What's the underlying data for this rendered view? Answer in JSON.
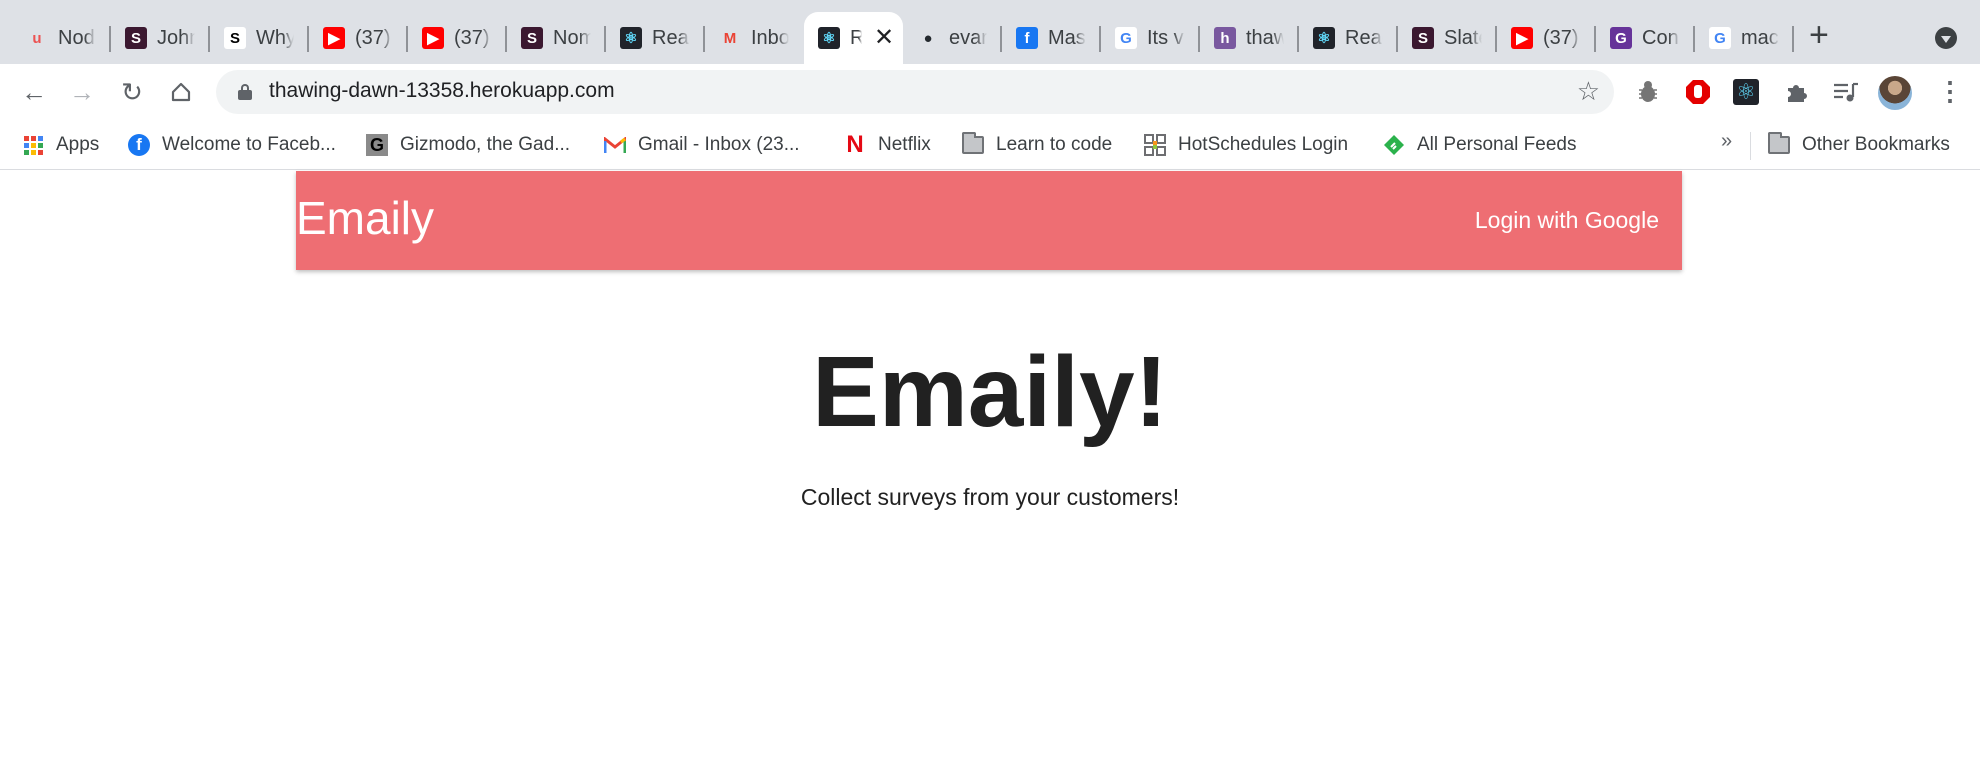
{
  "browser": {
    "tabs": [
      {
        "title": "Nod",
        "icon": "udemy-icon",
        "glyph": "u",
        "bg": "transparent",
        "fg": "#ec5252"
      },
      {
        "title": "John",
        "icon": "slate-icon",
        "glyph": "S",
        "bg": "#3b1830",
        "fg": "#ffffff"
      },
      {
        "title": "Why",
        "icon": "nyt-icon",
        "glyph": "S",
        "bg": "#ffffff",
        "fg": "#000000"
      },
      {
        "title": "(37)",
        "icon": "youtube-icon",
        "glyph": "▶",
        "bg": "#ff0000",
        "fg": "#ffffff"
      },
      {
        "title": "(37)",
        "icon": "youtube-icon",
        "glyph": "▶",
        "bg": "#ff0000",
        "fg": "#ffffff"
      },
      {
        "title": "Nom",
        "icon": "slate-icon",
        "glyph": "S",
        "bg": "#3b1830",
        "fg": "#ffffff"
      },
      {
        "title": "Reac",
        "icon": "react-icon",
        "glyph": "⚛",
        "bg": "#20232a",
        "fg": "#61dafb"
      },
      {
        "title": "Inbo",
        "icon": "gmail-icon",
        "glyph": "M",
        "bg": "transparent",
        "fg": "#ea4335"
      },
      {
        "title": "R",
        "icon": "react-icon",
        "glyph": "⚛",
        "bg": "#20232a",
        "fg": "#61dafb",
        "active": true
      },
      {
        "title": "evar",
        "icon": "github-icon",
        "glyph": "●",
        "bg": "transparent",
        "fg": "#24292e"
      },
      {
        "title": "Mas",
        "icon": "facebook-icon",
        "glyph": "f",
        "bg": "#1877f2",
        "fg": "#ffffff"
      },
      {
        "title": "Its v",
        "icon": "google-icon",
        "glyph": "G",
        "bg": "#ffffff",
        "fg": "#4285f4"
      },
      {
        "title": "thaw",
        "icon": "heroku-icon",
        "glyph": "h",
        "bg": "#79589f",
        "fg": "#ffffff"
      },
      {
        "title": "Reac",
        "icon": "react-icon",
        "glyph": "⚛",
        "bg": "#20232a",
        "fg": "#61dafb"
      },
      {
        "title": "Slate",
        "icon": "slate-icon",
        "glyph": "S",
        "bg": "#3b1830",
        "fg": "#ffffff"
      },
      {
        "title": "(37)",
        "icon": "youtube-icon",
        "glyph": "▶",
        "bg": "#ff0000",
        "fg": "#ffffff"
      },
      {
        "title": "Con",
        "icon": "gatsby-icon",
        "glyph": "G",
        "bg": "#663399",
        "fg": "#ffffff"
      },
      {
        "title": "mac",
        "icon": "google-icon",
        "glyph": "G",
        "bg": "#ffffff",
        "fg": "#4285f4"
      }
    ],
    "close_glyph": "✕",
    "new_tab_glyph": "+",
    "url": "thawing-dawn-13358.herokuapp.com",
    "bookmarks": [
      {
        "label": "Apps",
        "icon": "apps-grid-icon"
      },
      {
        "label": "Welcome to Faceb...",
        "icon": "facebook-icon"
      },
      {
        "label": "Gizmodo, the Gad...",
        "icon": "gizmodo-icon"
      },
      {
        "label": "Gmail - Inbox (23...",
        "icon": "gmail-icon"
      },
      {
        "label": "Netflix",
        "icon": "netflix-icon"
      },
      {
        "label": "Learn to code",
        "icon": "folder-icon"
      },
      {
        "label": "HotSchedules Login",
        "icon": "hotschedules-icon"
      },
      {
        "label": "All Personal Feeds",
        "icon": "feedly-icon"
      }
    ],
    "overflow_glyph": "»",
    "other_bookmarks": "Other Bookmarks"
  },
  "page": {
    "navbar": {
      "brand": "Emaily",
      "login": "Login with Google",
      "color": "#ee6e73"
    },
    "hero": {
      "title": "Emaily!",
      "subtitle": "Collect surveys from your customers!"
    }
  }
}
